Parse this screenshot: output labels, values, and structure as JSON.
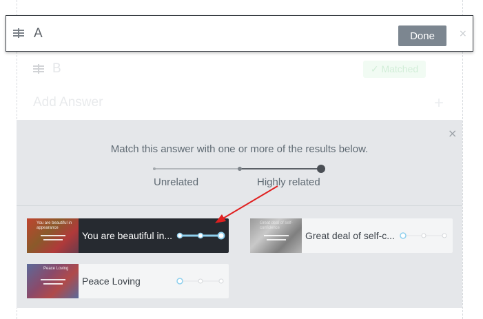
{
  "editor": {
    "answer_value": "A",
    "done_label": "Done",
    "close_glyph": "×"
  },
  "background_answers": {
    "answer_b": "B",
    "matched_badge": "✓ Matched",
    "add_answer": "Add Answer",
    "add_glyph": "+"
  },
  "match_panel": {
    "close_glyph": "×",
    "instruction": "Match this answer with one or more of the results below.",
    "scale_low_label": "Unrelated",
    "scale_high_label": "Highly related",
    "scale_level": 1.0
  },
  "results": [
    {
      "title": "You are beautiful in...",
      "thumb_text": "You are beautiful in appearance",
      "relation_level": "high",
      "selected": true
    },
    {
      "title": "Great deal of self-c...",
      "thumb_text": "Great deal of self-confidence",
      "relation_level": "none",
      "selected": false
    },
    {
      "title": "Peace Loving",
      "thumb_text": "Peace Loving",
      "relation_level": "none",
      "selected": false
    }
  ],
  "colors": {
    "done_button": "#7c8690",
    "panel_bg": "#e5e7ea",
    "active_result_bg": "#262a30",
    "slider_blue": "#8fd0ee",
    "annotation_arrow": "#e02020"
  },
  "icons": [
    "drag-handle-icon",
    "close-icon",
    "checkmark-icon",
    "plus-icon"
  ]
}
